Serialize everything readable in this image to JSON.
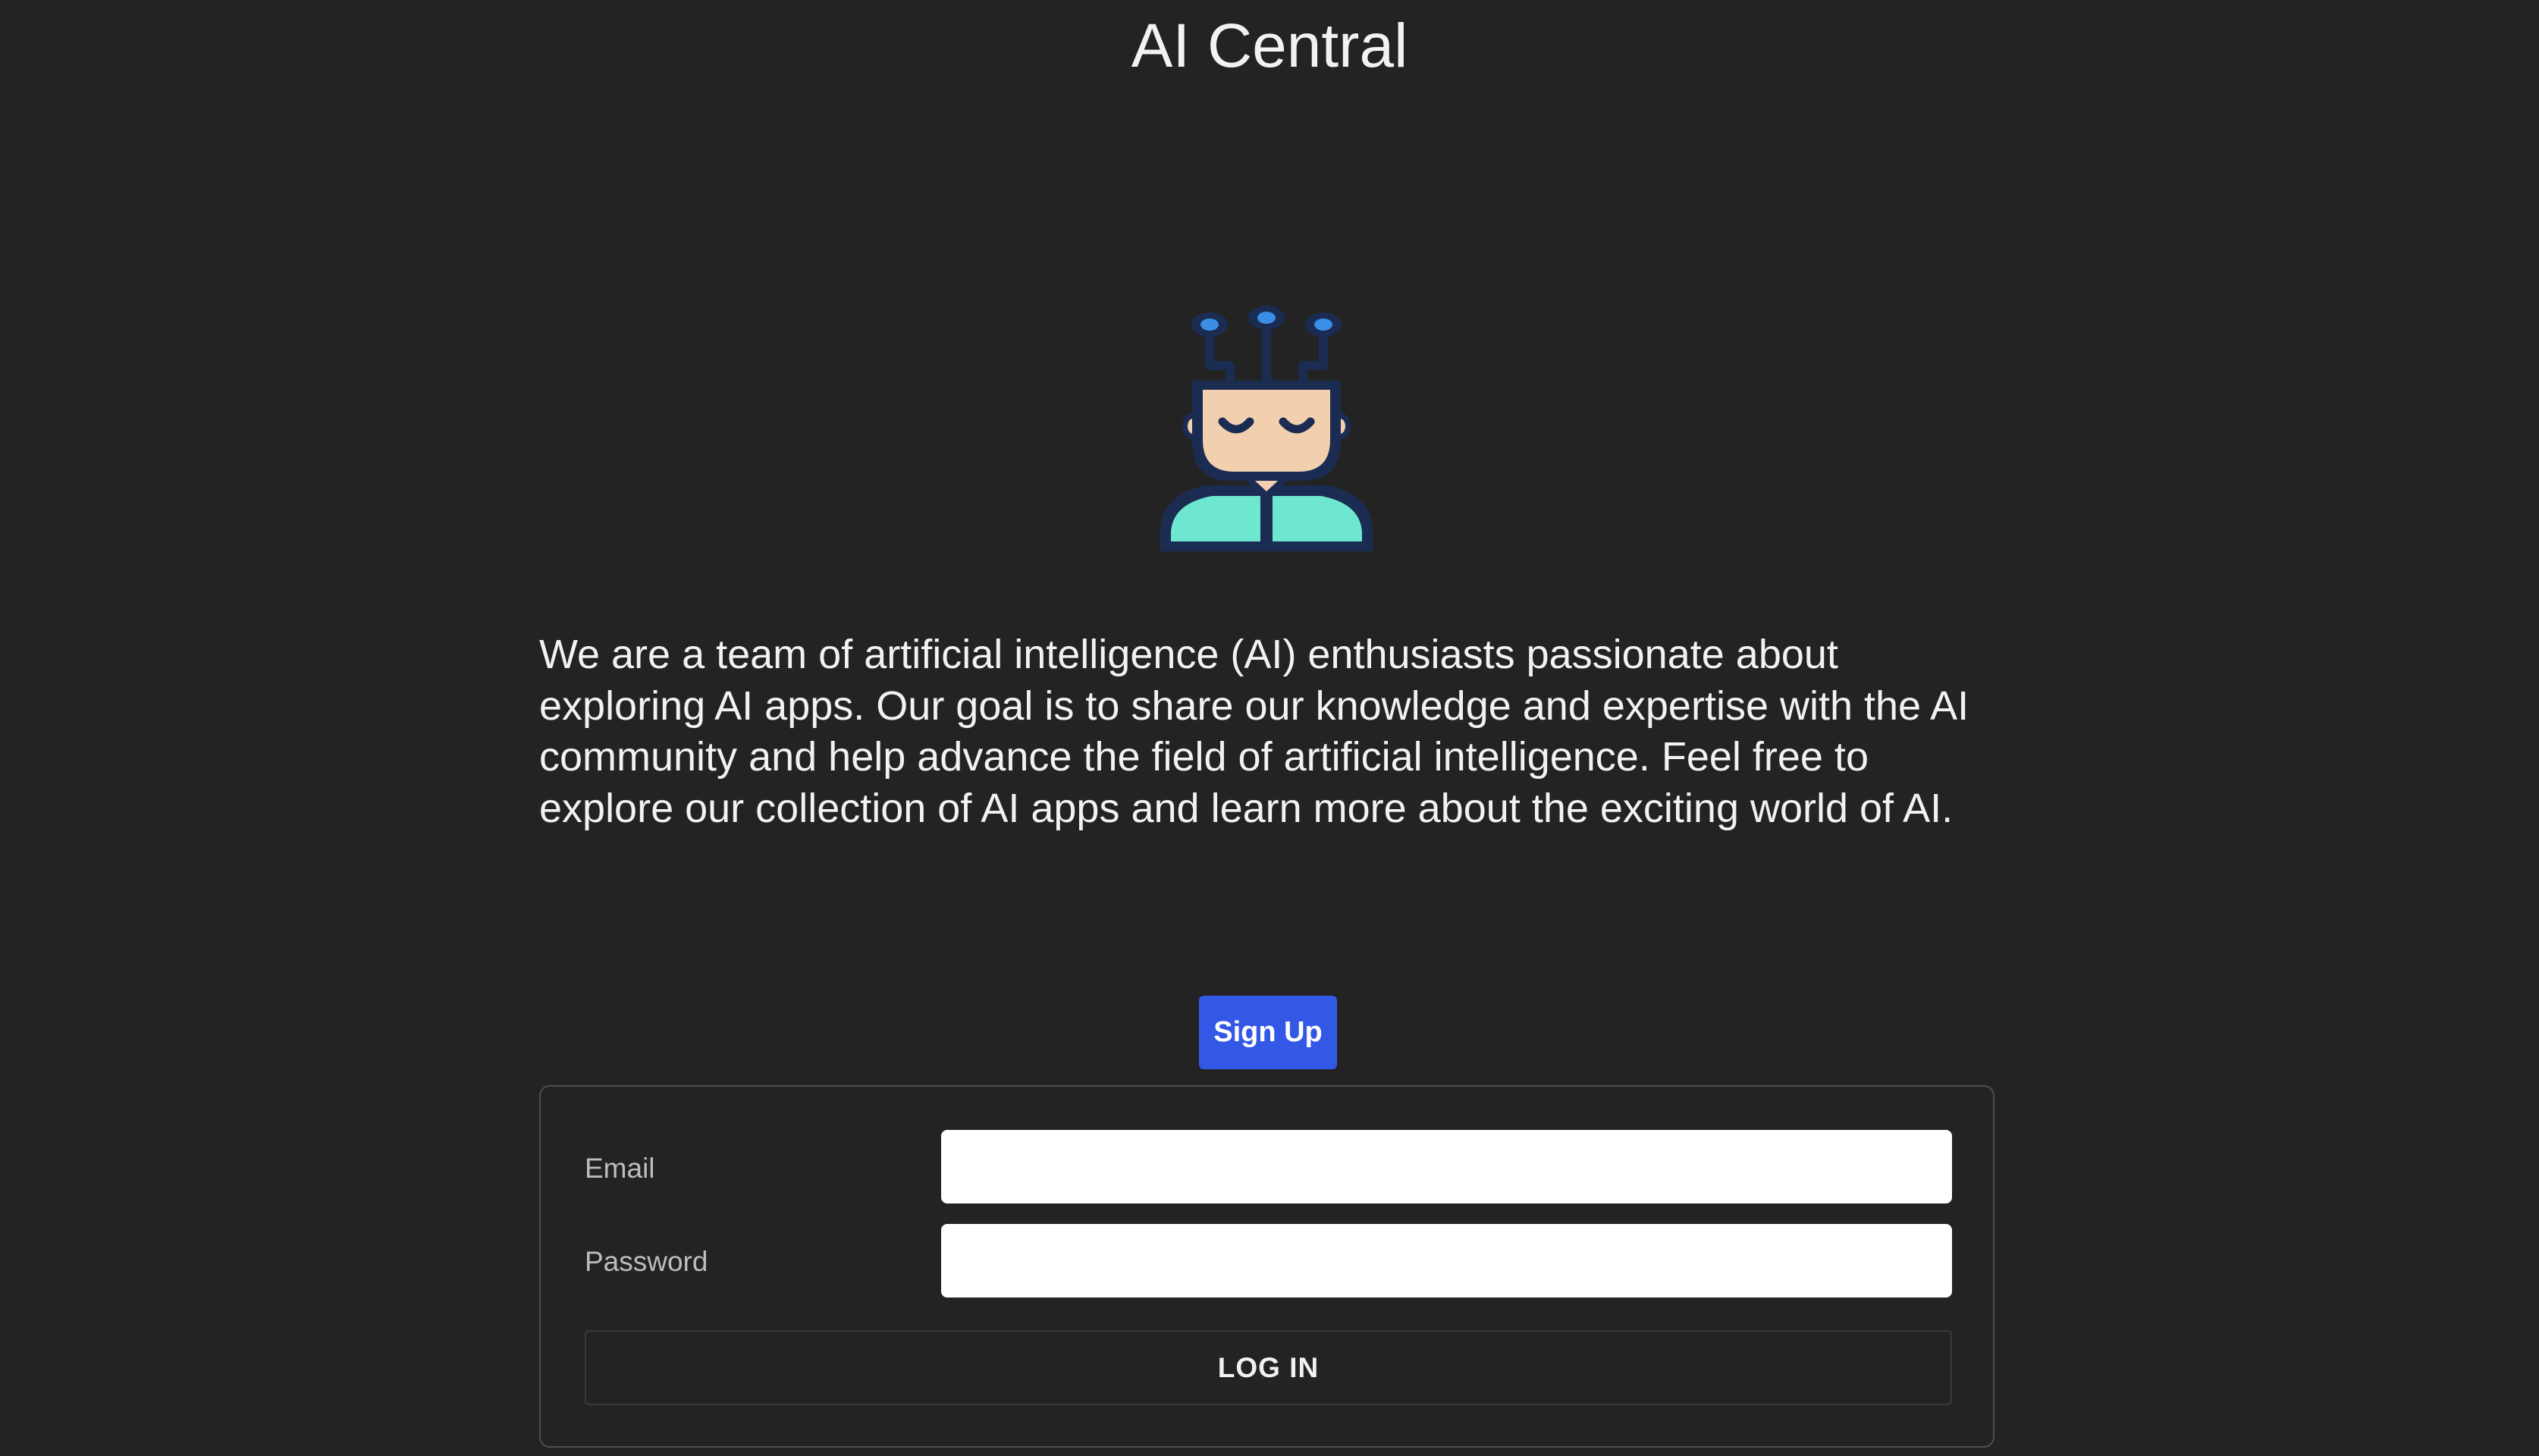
{
  "header": {
    "title": "AI Central"
  },
  "hero": {
    "mascot_icon": "ai-robot-head-icon",
    "description": "We are a team of artificial intelligence (AI) enthusiasts passionate about exploring AI apps. Our goal is to share our knowledge and expertise with the AI community and help advance the field of artificial intelligence. Feel free to explore our collection of AI apps and learn more about the exciting world of AI."
  },
  "signup": {
    "label": "Sign Up"
  },
  "login": {
    "email_label": "Email",
    "email_value": "",
    "password_label": "Password",
    "password_value": "",
    "submit_label": "LOG IN"
  },
  "colors": {
    "background": "#232323",
    "accent": "#3358e6",
    "mascot_outline": "#1b2c52",
    "mascot_skin": "#f2cfae",
    "mascot_body": "#6ee7d0",
    "mascot_nodes": "#3a8ee6"
  }
}
